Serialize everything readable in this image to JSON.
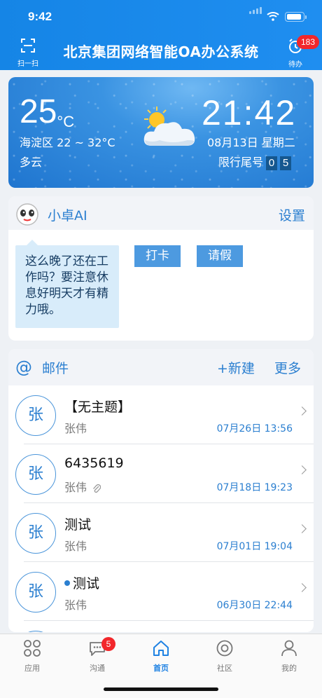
{
  "status_bar": {
    "time": "9:42"
  },
  "header": {
    "scan_label": "扫一扫",
    "title": "北京集团网络智能OA办公系统",
    "todo_label": "待办",
    "todo_badge": "183"
  },
  "weather": {
    "temperature": "25",
    "unit": "°C",
    "range": "海淀区 22 ~ 32°C",
    "condition": "多云",
    "clock": "21:42",
    "date": "08月13日 星期二",
    "limit_label": "限行尾号",
    "limit_numbers": [
      "0",
      "5"
    ],
    "icon": "partly-cloudy-icon"
  },
  "ai": {
    "name": "小卓AI",
    "settings": "设置",
    "message": "这么晚了还在工作吗？要注意休息好明天才有精力哦。",
    "buttons": [
      "打卡",
      "请假"
    ]
  },
  "mail": {
    "title": "邮件",
    "new": "+新建",
    "more": "更多",
    "items": [
      {
        "avatar": "张",
        "subject": "【无主题】",
        "sender": "张伟",
        "time": "07月26日 13:56",
        "unread": false,
        "attachment": false
      },
      {
        "avatar": "张",
        "subject": "6435619",
        "sender": "张伟",
        "time": "07月18日 19:23",
        "unread": false,
        "attachment": true
      },
      {
        "avatar": "张",
        "subject": "测试",
        "sender": "张伟",
        "time": "07月01日 19:04",
        "unread": false,
        "attachment": false
      },
      {
        "avatar": "张",
        "subject": "测试",
        "sender": "张伟",
        "time": "06月30日 22:44",
        "unread": true,
        "attachment": false
      }
    ]
  },
  "tabs": [
    {
      "label": "应用",
      "icon": "apps-icon",
      "active": false
    },
    {
      "label": "沟通",
      "icon": "chat-icon",
      "active": false,
      "badge": "5"
    },
    {
      "label": "首页",
      "icon": "home-icon",
      "active": true
    },
    {
      "label": "社区",
      "icon": "community-icon",
      "active": false
    },
    {
      "label": "我的",
      "icon": "profile-icon",
      "active": false
    }
  ],
  "colors": {
    "brand": "#1f8ef0",
    "accent": "#2b7fd0",
    "badge": "#f2272b"
  }
}
